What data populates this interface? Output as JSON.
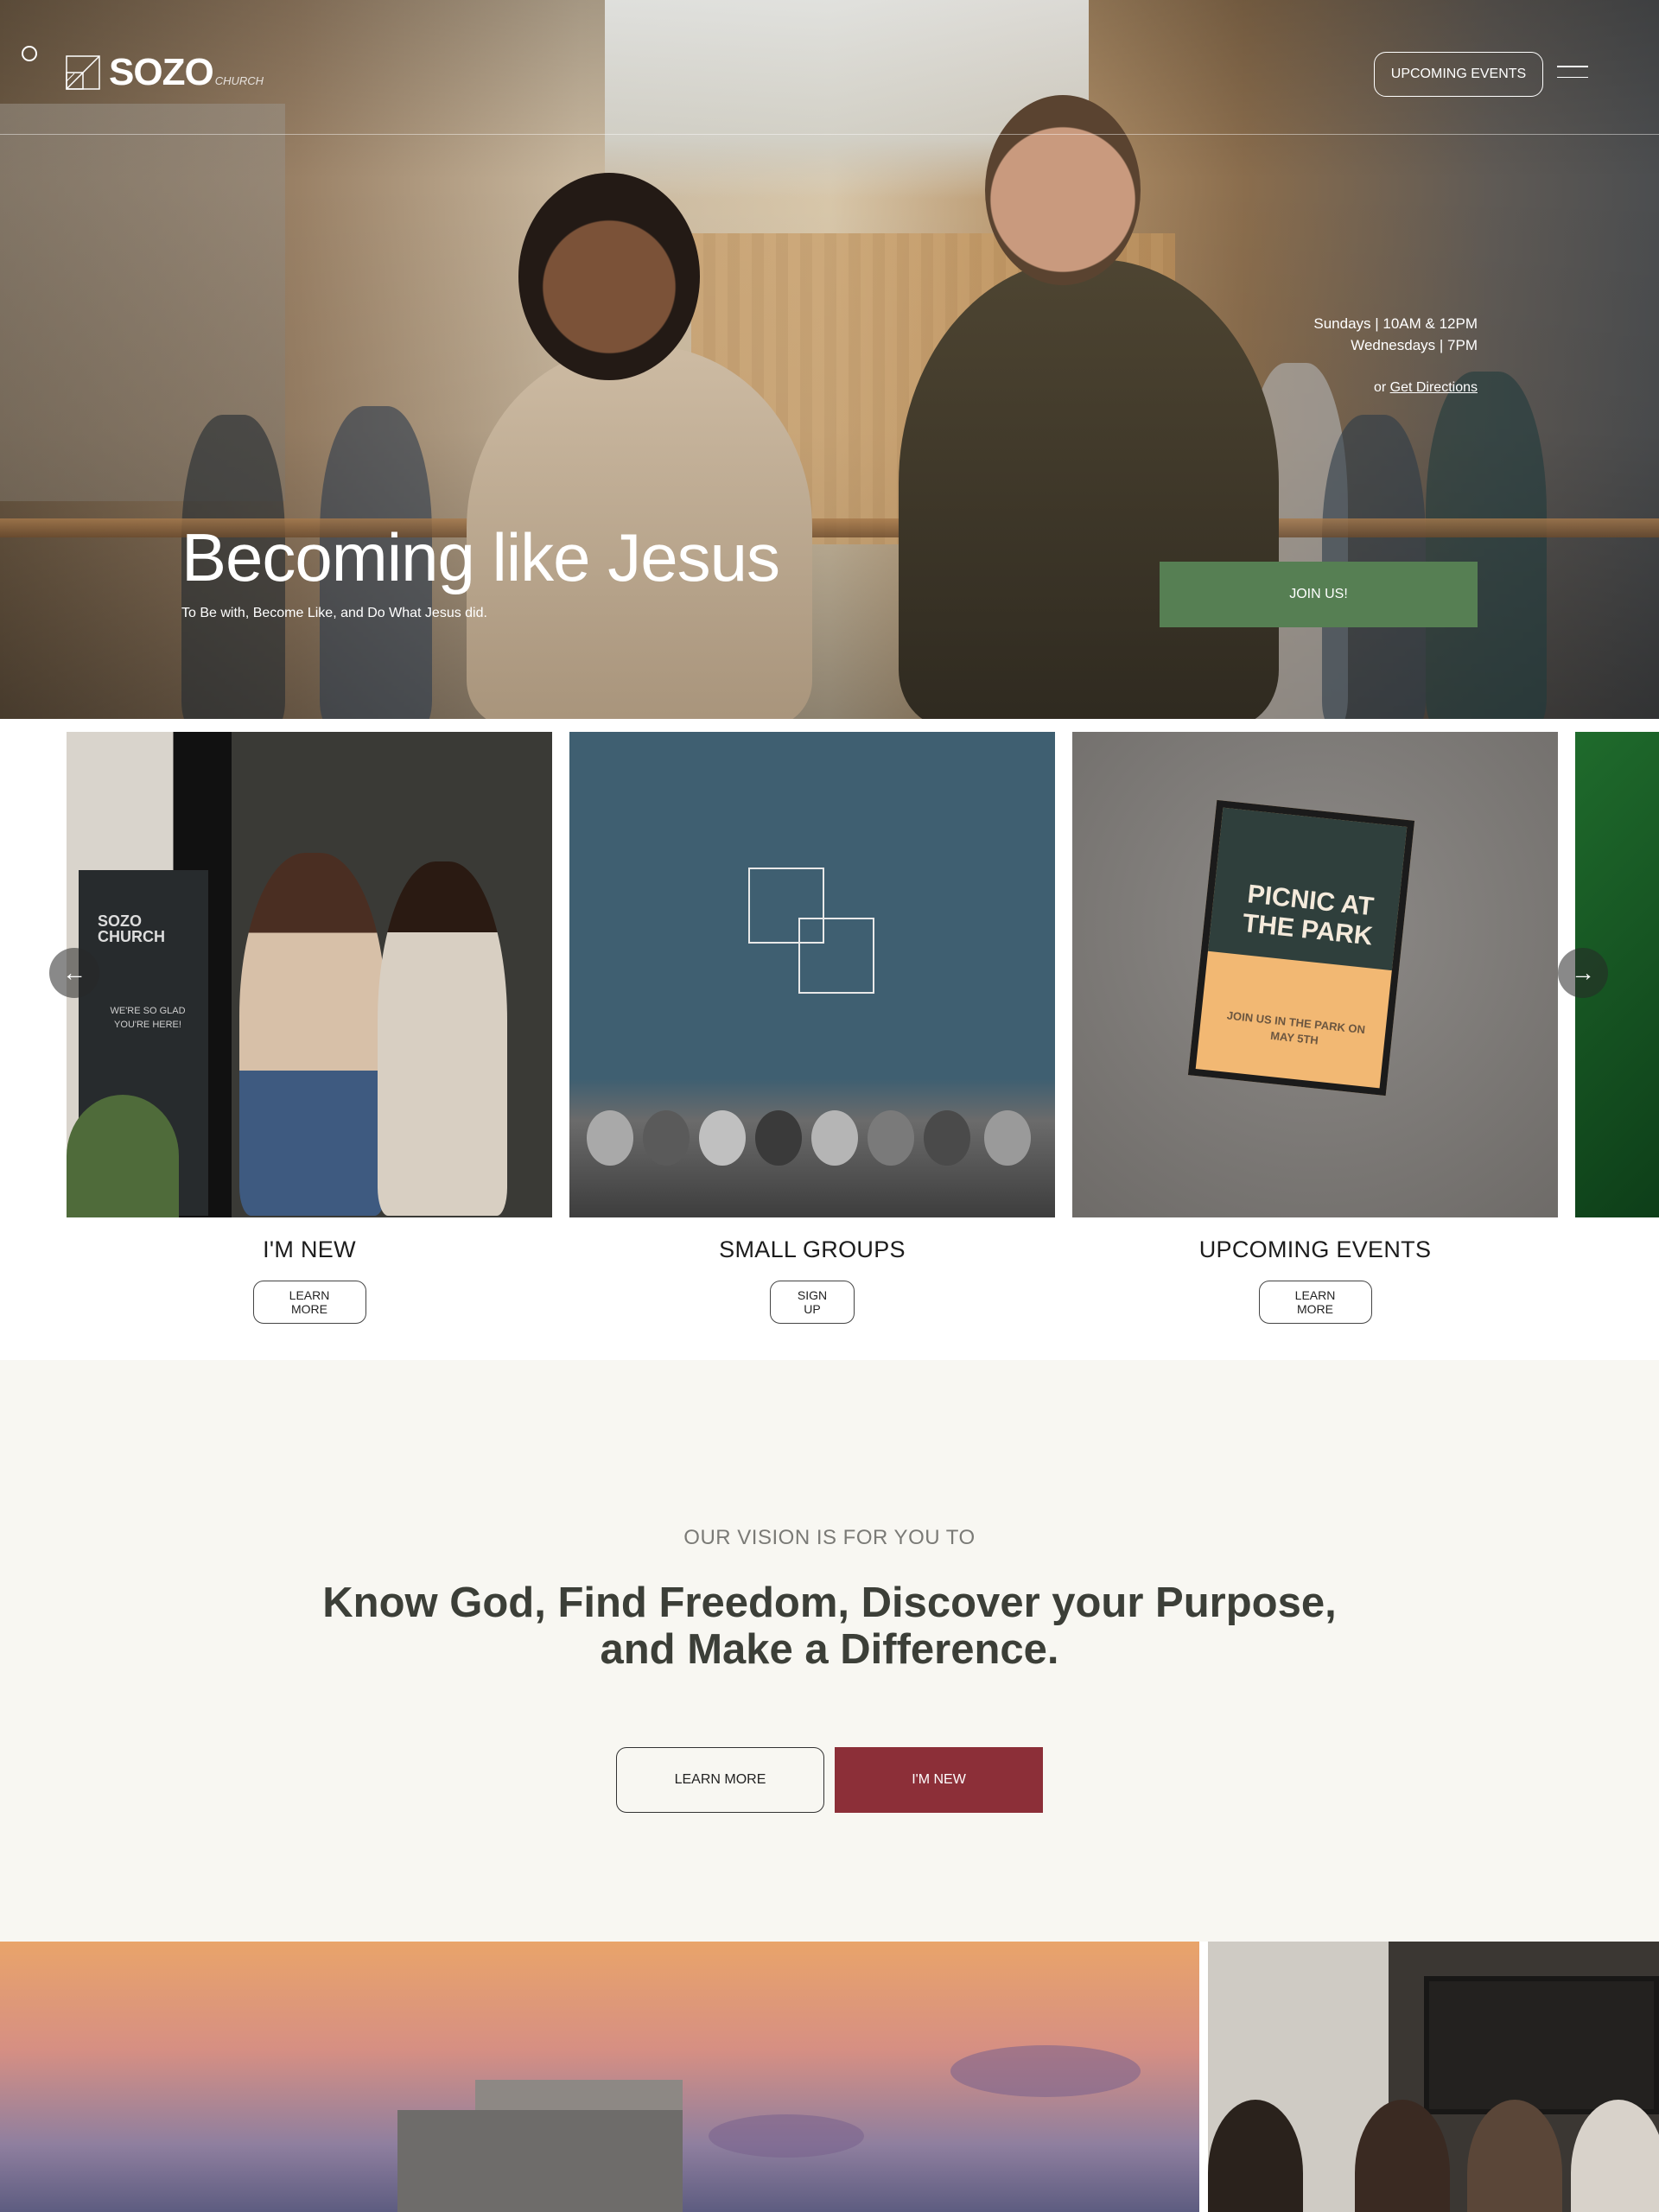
{
  "header": {
    "logo_word": "SOZO",
    "logo_sub": "CHURCH",
    "events_button": "UPCOMING EVENTS"
  },
  "hero": {
    "service_line_1": "Sundays  |  10AM & 12PM",
    "service_line_2": "Wednesdays  |  7PM",
    "directions_prefix": "or ",
    "directions_link": "Get Directions",
    "title": "Becoming like Jesus",
    "subtitle": "To Be with, Become Like, and Do What Jesus did.",
    "join_button": "JOIN US!"
  },
  "carousel": {
    "cards": [
      {
        "title": "I'M NEW",
        "button": "LEARN MORE",
        "sign_title": "SOZO CHURCH",
        "sign_text": "WE'RE SO GLAD YOU'RE HERE!"
      },
      {
        "title": "SMALL GROUPS",
        "button": "SIGN UP"
      },
      {
        "title": "UPCOMING EVENTS",
        "button": "LEARN MORE",
        "board_title": "PICNIC AT THE PARK",
        "board_text": "JOIN US IN THE PARK ON MAY 5TH"
      }
    ]
  },
  "vision": {
    "eyebrow": "OUR VISION IS FOR YOU TO",
    "headline": "Know God, Find Freedom, Discover your Purpose, and Make a Difference.",
    "learn_more": "LEARN MORE",
    "im_new": "I'M NEW"
  },
  "colors": {
    "join_green": "#567f53",
    "im_new_red": "#8c2f38",
    "vision_bg": "#f8f7f2",
    "headline_text": "#3c3f38"
  },
  "icons": {
    "carousel_prev": "arrow-left-icon",
    "carousel_next": "arrow-right-icon",
    "menu": "hamburger-menu-icon",
    "logo": "sozo-logo-mark-icon"
  }
}
